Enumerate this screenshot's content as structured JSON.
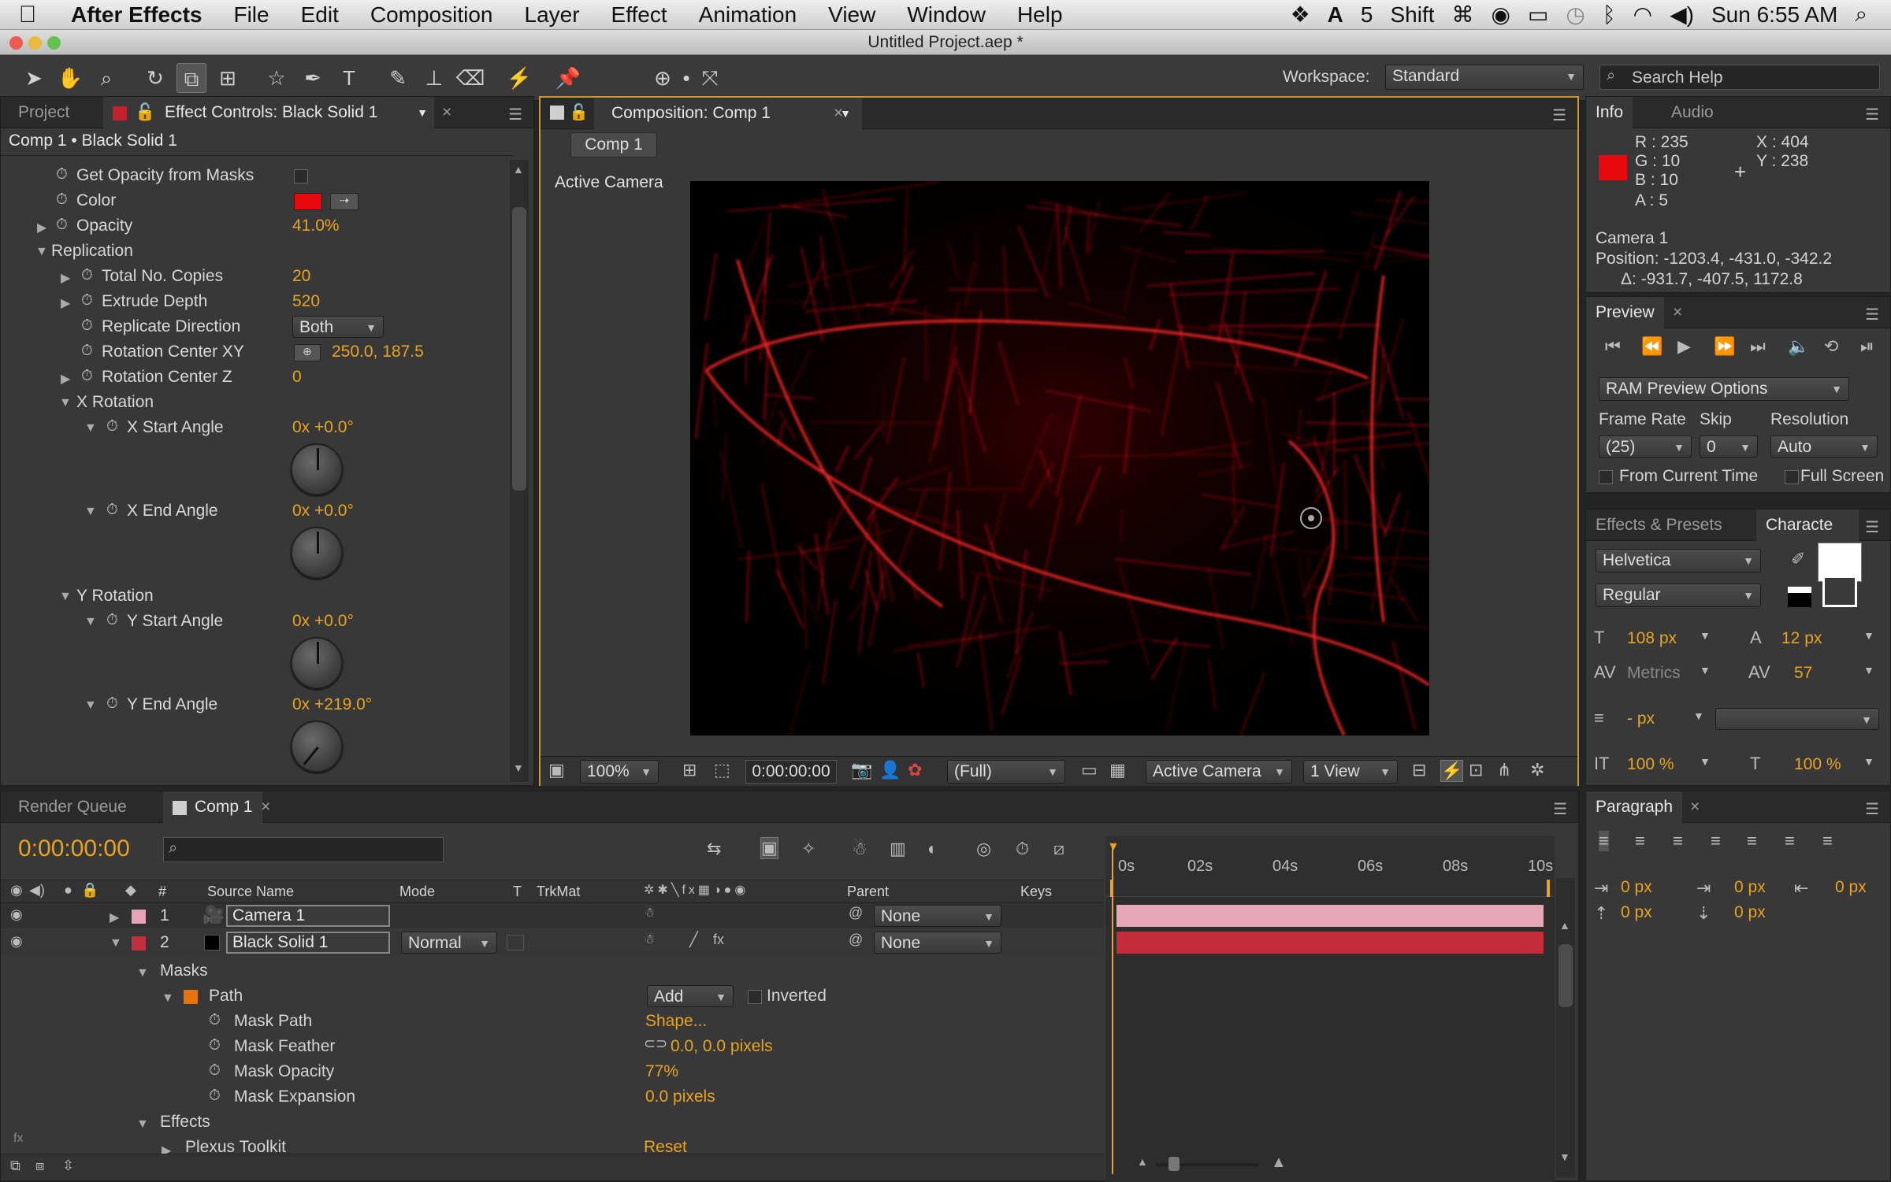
{
  "menubar": {
    "app": "After Effects",
    "items": [
      "File",
      "Edit",
      "Composition",
      "Layer",
      "Effect",
      "Animation",
      "View",
      "Window",
      "Help"
    ],
    "status": {
      "adobe_count": "5",
      "shift": "Shift",
      "clock": "Sun 6:55 AM"
    }
  },
  "window_title": "Untitled Project.aep *",
  "workspace": {
    "label": "Workspace:",
    "value": "Standard",
    "search_placeholder": "Search Help"
  },
  "left_panel": {
    "tab_project": "Project",
    "tab_effect_controls": "Effect Controls: Black Solid 1",
    "breadcrumb": "Comp 1 • Black Solid 1",
    "props": {
      "get_opacity": "Get Opacity from Masks",
      "color": "Color",
      "color_value": "#e8090f",
      "opacity": "Opacity",
      "opacity_val": "41.0%",
      "replication": "Replication",
      "total_copies": "Total No. Copies",
      "total_copies_val": "20",
      "extrude_depth": "Extrude Depth",
      "extrude_depth_val": "520",
      "replicate_dir": "Replicate Direction",
      "replicate_dir_val": "Both",
      "rot_center_xy": "Rotation Center XY",
      "rot_center_xy_val": "250.0, 187.5",
      "rot_center_z": "Rotation Center Z",
      "rot_center_z_val": "0",
      "x_rotation": "X Rotation",
      "x_start": "X Start Angle",
      "x_start_val": "0x +0.0°",
      "x_end": "X End Angle",
      "x_end_val": "0x +0.0°",
      "y_rotation": "Y Rotation",
      "y_start": "Y Start Angle",
      "y_start_val": "0x +0.0°",
      "y_end": "Y End Angle",
      "y_end_val": "0x +219.0°"
    }
  },
  "composition": {
    "tab": "Composition: Comp 1",
    "breadcrumb": "Comp 1",
    "camera_label": "Active Camera",
    "footer": {
      "zoom": "100%",
      "timecode": "0:00:00:00",
      "resolution": "(Full)",
      "view": "Active Camera",
      "views": "1 View"
    }
  },
  "info": {
    "tab_info": "Info",
    "tab_audio": "Audio",
    "r": "R : 235",
    "g": "G : 10",
    "b": "B : 10",
    "a": "A : 5",
    "x": "X : 404",
    "y": "Y : 238",
    "swatch": "#e8090f",
    "camera": "Camera 1",
    "position": "Position: -1203.4, -431.0, -342.2",
    "delta": "Δ: -931.7, -407.5, 1172.8"
  },
  "preview": {
    "tab": "Preview",
    "ram_options": "RAM Preview Options",
    "frame_rate_label": "Frame Rate",
    "skip_label": "Skip",
    "resolution_label": "Resolution",
    "frame_rate": "(25)",
    "skip": "0",
    "resolution": "Auto",
    "from_current": "From Current Time",
    "full_screen": "Full Screen"
  },
  "character": {
    "tab_effects": "Effects & Presets",
    "tab_character": "Characte",
    "font": "Helvetica",
    "style": "Regular",
    "size": "108 px",
    "leading": "12 px",
    "kerning": "Metrics",
    "tracking": "57",
    "stroke": "- px",
    "vscale": "100 %",
    "hscale": "100 %"
  },
  "paragraph": {
    "tab": "Paragraph",
    "indent_left": "0 px",
    "indent_first": "0 px",
    "indent_right": "0 px",
    "space_before": "0 px",
    "space_after": "0 px"
  },
  "timeline": {
    "tab_render": "Render Queue",
    "tab_comp": "Comp 1",
    "timecode": "0:00:00:00",
    "headers": {
      "num": "#",
      "source": "Source Name",
      "mode": "Mode",
      "t": "T",
      "trkmat": "TrkMat",
      "parent": "Parent",
      "keys": "Keys"
    },
    "ruler": [
      "0s",
      "02s",
      "04s",
      "06s",
      "08s",
      "10s"
    ],
    "layers": [
      {
        "num": "1",
        "name": "Camera 1",
        "parent": "None",
        "label_color": "#e7a3b6"
      },
      {
        "num": "2",
        "name": "Black Solid 1",
        "mode": "Normal",
        "parent": "None",
        "label_color": "#c2303e"
      }
    ],
    "masks": "Masks",
    "path": "Path",
    "path_mode": "Add",
    "inverted": "Inverted",
    "mask_props": [
      {
        "name": "Mask Path",
        "val": "Shape..."
      },
      {
        "name": "Mask Feather",
        "val": "0.0, 0.0 pixels"
      },
      {
        "name": "Mask Opacity",
        "val": "77%"
      },
      {
        "name": "Mask Expansion",
        "val": "0.0 pixels"
      }
    ],
    "effects": "Effects",
    "plexus": "Plexus Toolkit",
    "plexus_reset": "Reset"
  }
}
